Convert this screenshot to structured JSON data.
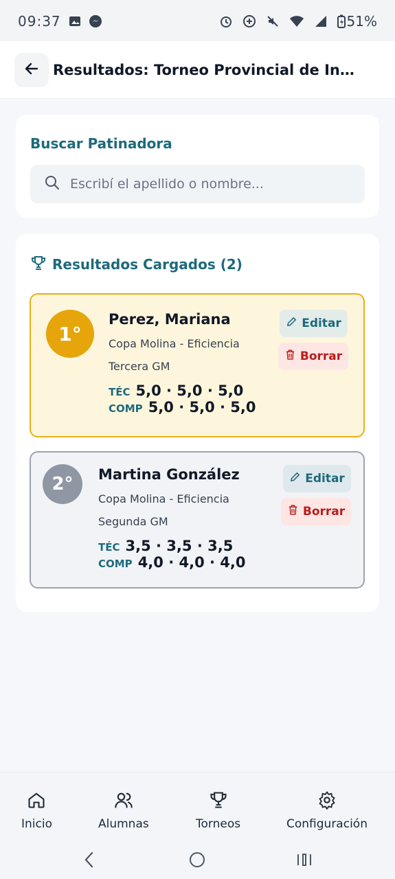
{
  "status_bar": {
    "time": "09:37",
    "battery": "51%"
  },
  "header": {
    "title": "Resultados: Torneo Provincial de Invierno"
  },
  "search": {
    "title": "Buscar Patinadora",
    "placeholder": "Escribí el apellido o nombre..."
  },
  "results": {
    "title": "Resultados Cargados (2)",
    "items": [
      {
        "position": "1°",
        "name": "Perez, Mariana",
        "category": "Copa Molina - Eficiencia",
        "level": "Tercera GM",
        "tec_label": "TÉC",
        "tec_scores": "5,0 · 5,0 · 5,0",
        "comp_label": "COMP",
        "comp_scores": "5,0 · 5,0 · 5,0",
        "edit_label": "Editar",
        "delete_label": "Borrar"
      },
      {
        "position": "2°",
        "name": "Martina González",
        "category": "Copa Molina - Eficiencia",
        "level": "Segunda GM",
        "tec_label": "TÉC",
        "tec_scores": "3,5 · 3,5 · 3,5",
        "comp_label": "COMP",
        "comp_scores": "4,0 · 4,0 · 4,0",
        "edit_label": "Editar",
        "delete_label": "Borrar"
      }
    ]
  },
  "bottom_nav": {
    "items": [
      {
        "label": "Inicio",
        "icon": "home-icon"
      },
      {
        "label": "Alumnas",
        "icon": "users-icon"
      },
      {
        "label": "Torneos",
        "icon": "trophy-icon"
      },
      {
        "label": "Configuración",
        "icon": "gear-icon"
      }
    ]
  },
  "colors": {
    "accent": "#1d6a7c",
    "gold": "#e6a50b",
    "silver": "#8e97a3",
    "danger": "#b91c1c"
  }
}
